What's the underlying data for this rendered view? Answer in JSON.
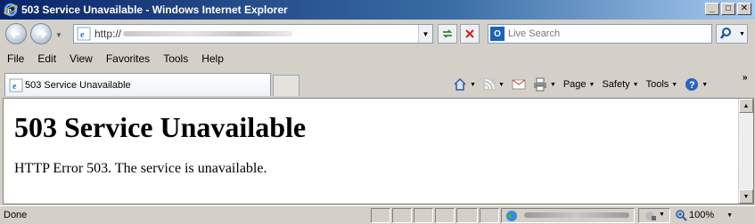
{
  "window": {
    "title": "503 Service Unavailable - Windows Internet Explorer",
    "controls": {
      "minimize": "_",
      "maximize": "□",
      "close": "✕"
    }
  },
  "address_bar": {
    "url": "http://",
    "url_obscured": true
  },
  "search": {
    "placeholder": "Live Search"
  },
  "menu": [
    "File",
    "Edit",
    "View",
    "Favorites",
    "Tools",
    "Help"
  ],
  "tabs": [
    {
      "label": "503 Service Unavailable",
      "active": true
    }
  ],
  "command_bar": {
    "page": "Page",
    "safety": "Safety",
    "tools": "Tools",
    "overflow": "»"
  },
  "page": {
    "heading": "503 Service Unavailable",
    "message": "HTTP Error 503. The service is unavailable."
  },
  "status_bar": {
    "status": "Done",
    "zoom": "100%"
  },
  "colors": {
    "title_bar_start": "#0a246a",
    "title_bar_end": "#a6caf0",
    "chrome": "#d4d0c8"
  }
}
